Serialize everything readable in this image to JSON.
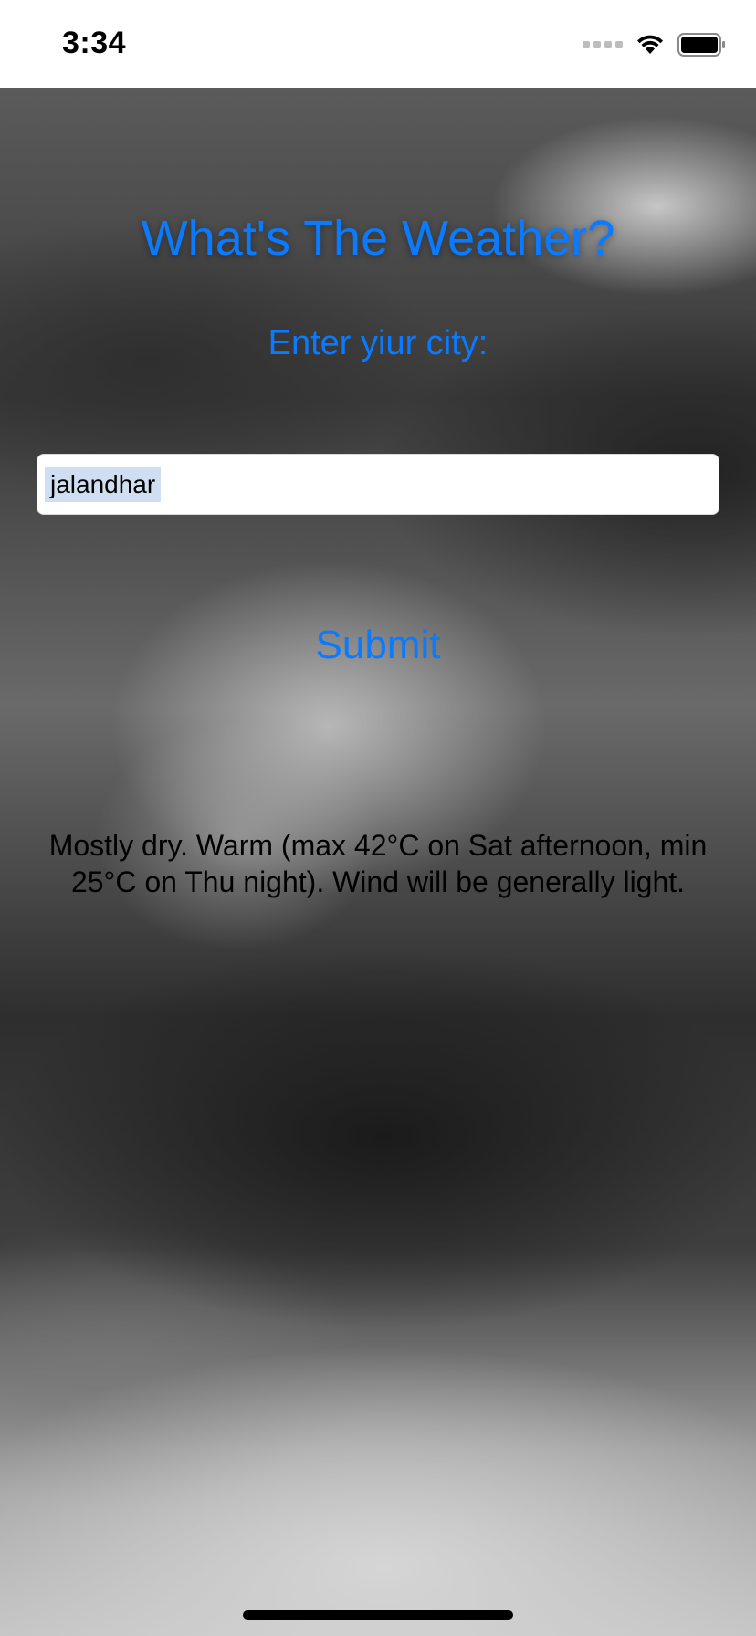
{
  "status_bar": {
    "time": "3:34",
    "signal_icon": "signal-dots-icon",
    "wifi_icon": "wifi-icon",
    "battery_icon": "battery-icon"
  },
  "app": {
    "title": "What's The Weather?",
    "prompt": "Enter yiur city:",
    "city_input": {
      "value": "jalandhar"
    },
    "submit_label": "Submit",
    "forecast": "Mostly dry. Warm (max 42°C on Sat afternoon, min 25°C on Thu night). Wind will be generally light."
  },
  "colors": {
    "accent": "#0a7aff",
    "selection": "#cfdef0"
  }
}
